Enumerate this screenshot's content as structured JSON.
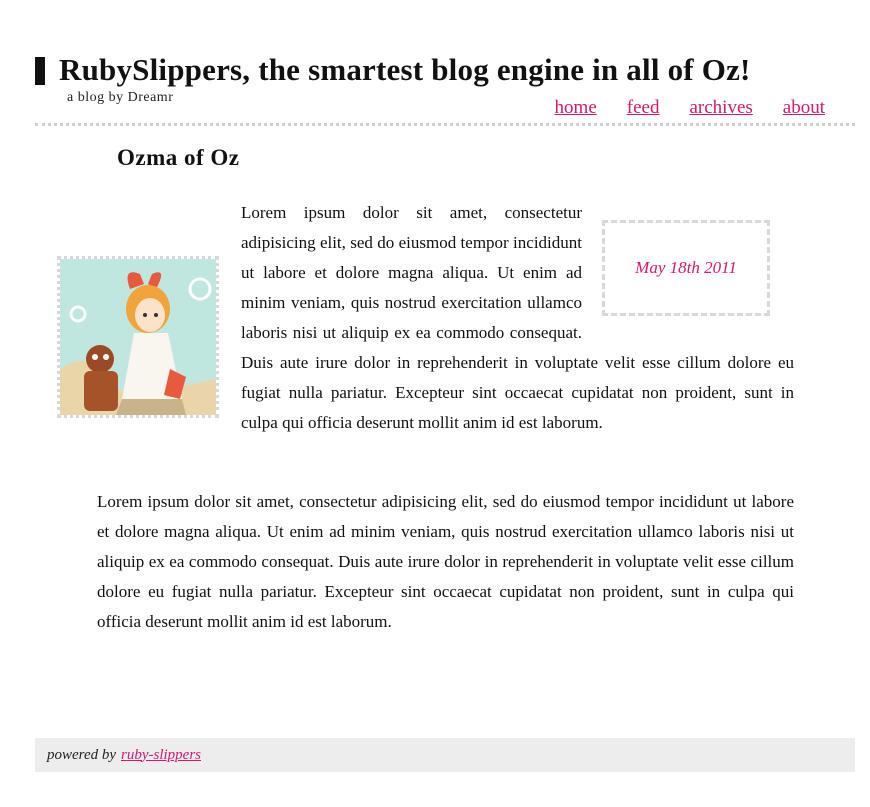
{
  "header": {
    "title": "RubySlippers, the smartest blog engine in all of Oz!",
    "tagline": "a blog by Dreamr",
    "nav": [
      "home",
      "feed",
      "archives",
      "about"
    ]
  },
  "post": {
    "title": "Ozma of Oz",
    "date": "May 18th 2011",
    "paragraph1": "Lorem ipsum dolor sit amet, consectetur adipisicing elit, sed do eiusmod tempor incididunt ut labore et dolore magna aliqua. Ut enim ad minim veniam, quis nostrud exercitation ullamco laboris nisi ut aliquip ex ea commodo consequat. Duis aute irure dolor in reprehenderit in voluptate velit esse cillum dolore eu fugiat nulla pariatur. Excepteur sint occaecat cupidatat non proident, sunt in culpa qui officia deserunt mollit anim id est laborum.",
    "paragraph2": "Lorem ipsum dolor sit amet, consectetur adipisicing elit, sed do eiusmod tempor incididunt ut labore et dolore magna aliqua. Ut enim ad minim veniam, quis nostrud exercitation ullamco laboris nisi ut aliquip ex ea commodo consequat. Duis aute irure dolor in reprehenderit in voluptate velit esse cillum dolore eu fugiat nulla pariatur. Excepteur sint occaecat cupidatat non proident, sunt in culpa qui officia deserunt mollit anim id est laborum.",
    "image_alt": "illustration of a girl with a bow and a robot"
  },
  "footer": {
    "powered_by": "powered by",
    "link": "ruby-slippers"
  },
  "colors": {
    "accent": "#d4186f",
    "footer_bg": "#ededed",
    "border": "#d8d8d8"
  }
}
